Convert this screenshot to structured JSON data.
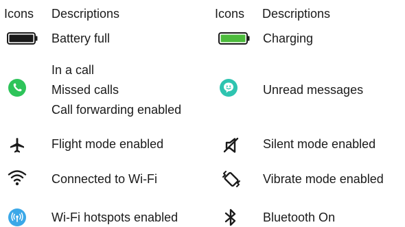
{
  "header": {
    "left": {
      "icons": "Icons",
      "descriptions": "Descriptions"
    },
    "right": {
      "icons": "Icons",
      "descriptions": "Descriptions"
    }
  },
  "rows": {
    "battery_full": {
      "label": "Battery full",
      "icon": "battery-full-icon",
      "color": "#1a1a1a"
    },
    "charging": {
      "label": "Charging",
      "icon": "battery-charging-icon",
      "color": "#4cbb3c"
    },
    "call": {
      "icon": "phone-icon",
      "color": "#2ec45a",
      "lines": [
        "In a call",
        "Missed calls",
        "Call forwarding enabled"
      ]
    },
    "unread": {
      "label": "Unread messages",
      "icon": "message-smiley-icon",
      "color": "#2ec4b0"
    },
    "flight": {
      "label": "Flight mode enabled",
      "icon": "airplane-icon"
    },
    "silent": {
      "label": "Silent mode enabled",
      "icon": "speaker-muted-icon"
    },
    "wifi": {
      "label": "Connected to Wi-Fi",
      "icon": "wifi-icon"
    },
    "vibrate": {
      "label": "Vibrate mode enabled",
      "icon": "vibrate-icon"
    },
    "hotspot": {
      "label": "Wi-Fi hotspots enabled",
      "icon": "hotspot-icon",
      "color": "#3ba8e8"
    },
    "bluetooth": {
      "label": "Bluetooth On",
      "icon": "bluetooth-icon"
    }
  }
}
